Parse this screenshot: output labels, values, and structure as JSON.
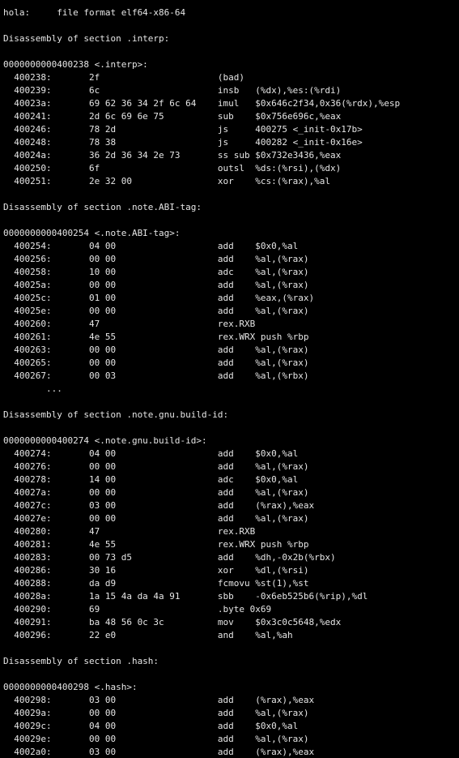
{
  "terminal": {
    "lines": [
      "hola:     file format elf64-x86-64",
      "",
      "Disassembly of section .interp:",
      "",
      "0000000000400238 <.interp>:",
      "  400238:\t2f                   \t(bad)  ",
      "  400239:\t6c                   \tinsb   (%dx),%es:(%rdi)",
      "  40023a:\t69 62 36 34 2f 6c 64 \timul   $0x646c2f34,0x36(%rdx),%esp",
      "  400241:\t2d 6c 69 6e 75       \tsub    $0x756e696c,%eax",
      "  400246:\t78 2d                \tjs     400275 <_init-0x17b>",
      "  400248:\t78 38                \tjs     400282 <_init-0x16e>",
      "  40024a:\t36 2d 36 34 2e 73    \tss sub $0x732e3436,%eax",
      "  400250:\t6f                   \toutsl  %ds:(%rsi),(%dx)",
      "  400251:\t2e 32 00             \txor    %cs:(%rax),%al",
      "",
      "Disassembly of section .note.ABI-tag:",
      "",
      "0000000000400254 <.note.ABI-tag>:",
      "  400254:\t04 00                \tadd    $0x0,%al",
      "  400256:\t00 00                \tadd    %al,(%rax)",
      "  400258:\t10 00                \tadc    %al,(%rax)",
      "  40025a:\t00 00                \tadd    %al,(%rax)",
      "  40025c:\t01 00                \tadd    %eax,(%rax)",
      "  40025e:\t00 00                \tadd    %al,(%rax)",
      "  400260:\t47                   \trex.RXB",
      "  400261:\t4e 55                \trex.WRX push %rbp",
      "  400263:\t00 00                \tadd    %al,(%rax)",
      "  400265:\t00 00                \tadd    %al,(%rax)",
      "  400267:\t00 03                \tadd    %al,(%rbx)",
      "        ...",
      "",
      "Disassembly of section .note.gnu.build-id:",
      "",
      "0000000000400274 <.note.gnu.build-id>:",
      "  400274:\t04 00                \tadd    $0x0,%al",
      "  400276:\t00 00                \tadd    %al,(%rax)",
      "  400278:\t14 00                \tadc    $0x0,%al",
      "  40027a:\t00 00                \tadd    %al,(%rax)",
      "  40027c:\t03 00                \tadd    (%rax),%eax",
      "  40027e:\t00 00                \tadd    %al,(%rax)",
      "  400280:\t47                   \trex.RXB",
      "  400281:\t4e 55                \trex.WRX push %rbp",
      "  400283:\t00 73 d5             \tadd    %dh,-0x2b(%rbx)",
      "  400286:\t30 16                \txor    %dl,(%rsi)",
      "  400288:\tda d9                \tfcmovu %st(1),%st",
      "  40028a:\t1a 15 4a da 4a 91    \tsbb    -0x6eb525b6(%rip),%dl",
      "  400290:\t69                   \t.byte 0x69",
      "  400291:\tba 48 56 0c 3c       \tmov    $0x3c0c5648,%edx",
      "  400296:\t22 e0                \tand    %al,%ah",
      "",
      "Disassembly of section .hash:",
      "",
      "0000000000400298 <.hash>:",
      "  400298:\t03 00                \tadd    (%rax),%eax",
      "  40029a:\t00 00                \tadd    %al,(%rax)",
      "  40029c:\t04 00                \tadd    $0x0,%al",
      "  40029e:\t00 00                \tadd    %al,(%rax)",
      "  4002a0:\t03 00                \tadd    (%rax),%eax"
    ]
  }
}
